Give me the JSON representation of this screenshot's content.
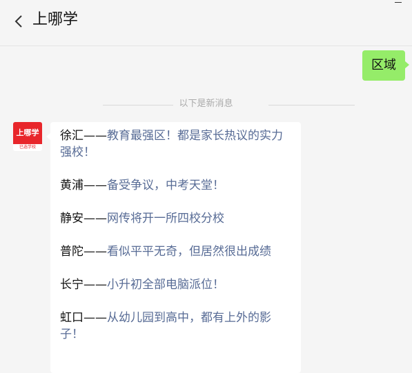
{
  "header": {
    "title": "上哪学"
  },
  "messages": {
    "outgoing_text": "区域",
    "divider_text": "以下是新消息",
    "avatar": {
      "brand": "上哪学",
      "sub": "已选学校"
    },
    "items": [
      {
        "place": "徐汇",
        "sep": "——",
        "desc": "教育最强区！都是家长热议的实力强校！"
      },
      {
        "place": "黄浦",
        "sep": "——",
        "desc": "备受争议，中考天堂！"
      },
      {
        "place": "静安",
        "sep": "——",
        "desc": "网传将开一所四校分校"
      },
      {
        "place": "普陀",
        "sep": "——",
        "desc": "看似平平无奇，但居然很出成绩"
      },
      {
        "place": "长宁",
        "sep": "——",
        "desc": "小升初全部电脑派位！"
      },
      {
        "place": "虹口",
        "sep": "——",
        "desc": "从幼儿园到高中，都有上外的影子！"
      }
    ]
  }
}
